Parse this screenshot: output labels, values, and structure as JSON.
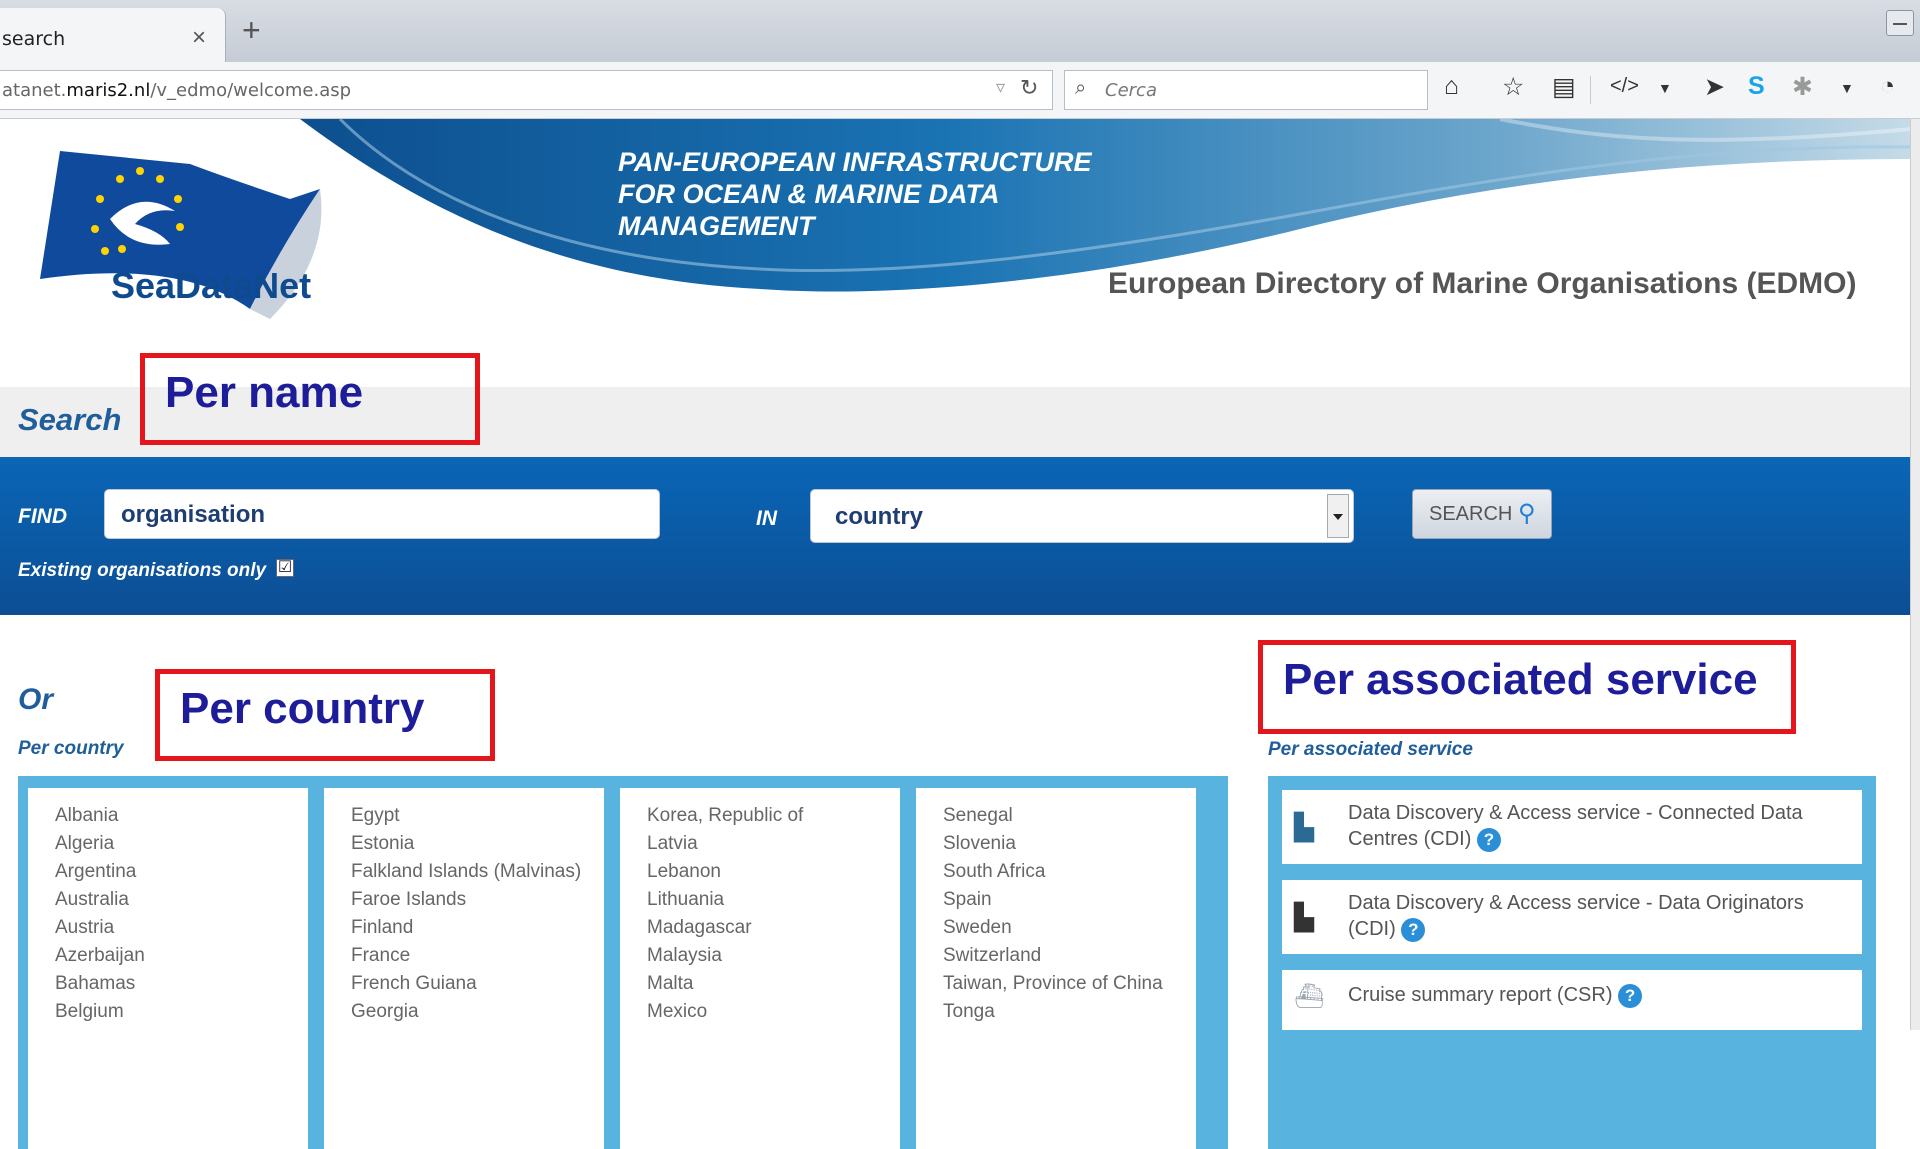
{
  "browser": {
    "tab_title": "search",
    "tab_close": "×",
    "new_tab": "+",
    "url_prefix": "atanet.",
    "url_domain": "maris2.nl",
    "url_path": "/v_edmo/welcome.asp",
    "url_dropdown": "▿",
    "reload": "↻",
    "search_placeholder": "Cerca",
    "toolbar_icons": [
      "home-icon",
      "bookmark-star-icon",
      "clipboard-icon",
      "code-icon",
      "send-icon",
      "skype-icon",
      "puzzle-icon",
      "history-icon"
    ]
  },
  "header": {
    "hero_title": "PAN-EUROPEAN INFRASTRUCTURE FOR OCEAN & MARINE DATA MANAGEMENT",
    "logo_text": "SeaDataNet",
    "edmo_title": "European Directory of Marine Organisations (EDMO)"
  },
  "annotations": {
    "per_name": "Per name",
    "per_country": "Per country",
    "per_service": "Per associated service"
  },
  "search": {
    "heading": "Search",
    "find_label": "FIND",
    "find_value": "organisation",
    "in_label": "IN",
    "in_value": "country",
    "search_button": "SEARCH",
    "existing_only_label": "Existing organisations only",
    "existing_only_checked": "☑"
  },
  "browse": {
    "or_heading": "Or",
    "per_country_label": "Per country",
    "per_service_label": "Per associated service",
    "country_columns": [
      [
        "Albania",
        "Algeria",
        "Argentina",
        "Australia",
        "Austria",
        "Azerbaijan",
        "Bahamas",
        "Belgium"
      ],
      [
        "Egypt",
        "Estonia",
        "Falkland Islands (Malvinas)",
        "Faroe Islands",
        "Finland",
        "France",
        "French Guiana",
        "Georgia"
      ],
      [
        "Korea, Republic of",
        "Latvia",
        "Lebanon",
        "Lithuania",
        "Madagascar",
        "Malaysia",
        "Malta",
        "Mexico"
      ],
      [
        "Senegal",
        "Slovenia",
        "South Africa",
        "Spain",
        "Sweden",
        "Switzerland",
        "Taiwan, Province of China",
        "Tonga"
      ]
    ],
    "services": [
      {
        "label": "Data Discovery & Access service - Connected Data Centres (CDI)",
        "icon": "building-icon"
      },
      {
        "label": "Data Discovery & Access service - Data Originators (CDI)",
        "icon": "building-dark-icon"
      },
      {
        "label": "Cruise summary report (CSR)",
        "icon": "ship-icon"
      }
    ],
    "help_glyph": "?"
  },
  "colors": {
    "brand_blue": "#0c5aa6",
    "panel_frame": "#58b4df",
    "heading_blue": "#1f5e9b",
    "annotation_red": "#e4151b",
    "annotation_text": "#1d1d9a"
  }
}
